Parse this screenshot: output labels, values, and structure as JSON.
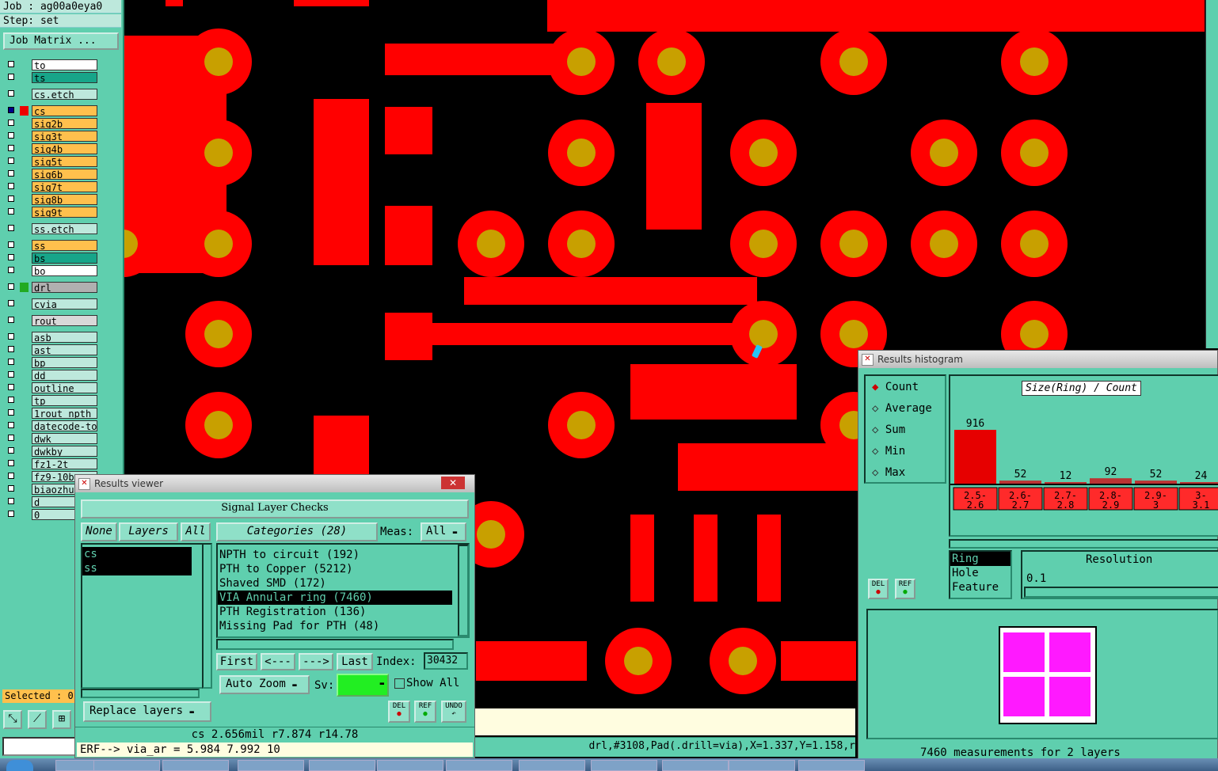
{
  "left": {
    "job_line": "Job : ag00a0eya0",
    "step_line": "Step: set",
    "job_matrix_label": "Job Matrix ...",
    "layers": [
      {
        "name": "to",
        "color": "#ffffff",
        "checked": false
      },
      {
        "name": "ts",
        "color": "#17a589",
        "checked": false
      },
      {
        "name": "cs.etch",
        "color": "#bde8dc",
        "checked": false
      },
      {
        "name": "cs",
        "color": "#ffc04d",
        "checked": true
      },
      {
        "name": "sig2b",
        "color": "#ffc04d",
        "checked": false
      },
      {
        "name": "sig3t",
        "color": "#ffc04d",
        "checked": false
      },
      {
        "name": "sig4b",
        "color": "#ffc04d",
        "checked": false
      },
      {
        "name": "sig5t",
        "color": "#ffc04d",
        "checked": false
      },
      {
        "name": "sig6b",
        "color": "#ffc04d",
        "checked": false
      },
      {
        "name": "sig7t",
        "color": "#ffc04d",
        "checked": false
      },
      {
        "name": "sig8b",
        "color": "#ffc04d",
        "checked": false
      },
      {
        "name": "sig9t",
        "color": "#ffc04d",
        "checked": false
      },
      {
        "name": "ss.etch",
        "color": "#bde8dc",
        "checked": false
      },
      {
        "name": "ss",
        "color": "#ffc04d",
        "checked": false
      },
      {
        "name": "bs",
        "color": "#17a589",
        "checked": false
      },
      {
        "name": "bo",
        "color": "#ffffff",
        "checked": false
      },
      {
        "name": "drl",
        "color": "#b0b0b0",
        "checked": false
      },
      {
        "name": "cvia",
        "color": "#bde8dc",
        "checked": false
      },
      {
        "name": "rout",
        "color": "#d8d8d8",
        "checked": false
      },
      {
        "name": "asb",
        "color": "#bde8dc",
        "checked": false
      },
      {
        "name": "ast",
        "color": "#bde8dc",
        "checked": false
      },
      {
        "name": "bp",
        "color": "#bde8dc",
        "checked": false
      },
      {
        "name": "dd",
        "color": "#bde8dc",
        "checked": false
      },
      {
        "name": "outline",
        "color": "#bde8dc",
        "checked": false
      },
      {
        "name": "tp",
        "color": "#bde8dc",
        "checked": false
      },
      {
        "name": "1rout_npth_",
        "color": "#bde8dc",
        "checked": false
      },
      {
        "name": "datecode-to",
        "color": "#bde8dc",
        "checked": false
      },
      {
        "name": "dwk",
        "color": "#bde8dc",
        "checked": false
      },
      {
        "name": "dwkby",
        "color": "#bde8dc",
        "checked": false
      },
      {
        "name": "fz1-2t",
        "color": "#bde8dc",
        "checked": false
      },
      {
        "name": "fz9-10b",
        "color": "#bde8dc",
        "checked": false
      },
      {
        "name": "biaozhu",
        "color": "#bde8dc",
        "checked": false
      },
      {
        "name": "d",
        "color": "#bde8dc",
        "checked": false
      },
      {
        "name": "0",
        "color": "#bde8dc",
        "checked": false
      }
    ],
    "selected_label": "Selected : 0"
  },
  "viewer": {
    "title": "Results viewer",
    "header": "Signal Layer Checks",
    "none_btn": "None",
    "layers_btn": "Layers",
    "all_btn": "All",
    "categories_btn": "Categories (28)",
    "meas_label": "Meas:",
    "meas_value": "All",
    "selected_layers": [
      "cs",
      "ss"
    ],
    "categories": [
      {
        "text": "NPTH to circuit (192)",
        "selected": false
      },
      {
        "text": "PTH to Copper (5212)",
        "selected": false
      },
      {
        "text": "Shaved SMD (172)",
        "selected": false
      },
      {
        "text": "VIA Annular ring (7460)",
        "selected": true
      },
      {
        "text": "PTH Registration (136)",
        "selected": false
      },
      {
        "text": "Missing Pad for PTH (48)",
        "selected": false
      }
    ],
    "first": "First",
    "prev": "<---",
    "next": "--->",
    "last": "Last",
    "index_label": "Index:",
    "index_value": "30432",
    "auto_zoom": "Auto Zoom",
    "sv_label": "Sv:",
    "show_all": "Show All",
    "replace_layers": "Replace layers",
    "del": "DEL",
    "ref": "REF",
    "undo": "UNDO",
    "status": "cs 2.656mil  r7.874  r14.78",
    "erf_line": "ERF--> via_ar = 5.984 7.992 10"
  },
  "status_right": "drl,#3108,Pad(.drill=via),X=1.337,Y=1.158,r",
  "histogram": {
    "title": "Results histogram",
    "modes": [
      {
        "label": "Count",
        "selected": true
      },
      {
        "label": "Average",
        "selected": false
      },
      {
        "label": "Sum",
        "selected": false
      },
      {
        "label": "Min",
        "selected": false
      },
      {
        "label": "Max",
        "selected": false
      }
    ],
    "chart_title": "Size(Ring) / Count",
    "resolution_label": "Resolution",
    "resolution_value": "0.1",
    "fields": [
      {
        "label": "Ring",
        "selected": true
      },
      {
        "label": "Hole",
        "selected": false
      },
      {
        "label": "Feature",
        "selected": false
      }
    ],
    "del": "DEL",
    "ref": "REF",
    "footer": "7460 measurements for 2 layers"
  },
  "chart_data": {
    "type": "bar",
    "title": "Size(Ring) / Count",
    "categories": [
      "2.5-2.6",
      "2.6-2.7",
      "2.7-2.8",
      "2.8-2.9",
      "2.9-3",
      "3-3.1"
    ],
    "category_labels_top": [
      "2.5-",
      "2.6-",
      "2.7-",
      "2.8-",
      "2.9-",
      "3-"
    ],
    "category_labels_bottom": [
      "2.6",
      "2.7",
      "2.8",
      "2.9",
      "3",
      "3.1"
    ],
    "values": [
      916,
      52,
      12,
      92,
      52,
      24
    ],
    "ylim": [
      0,
      916
    ]
  }
}
